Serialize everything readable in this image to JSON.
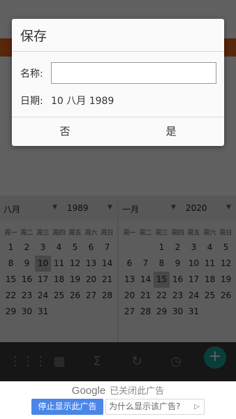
{
  "dialog": {
    "title": "保存",
    "name_label": "名称:",
    "name_value": "",
    "date_label": "日期:",
    "date_value": "10 八月 1989",
    "no_label": "否",
    "yes_label": "是"
  },
  "calendar_left": {
    "month": "八月",
    "year": "1989",
    "weekdays": [
      "周一",
      "周二",
      "周三",
      "周四",
      "周五",
      "周六",
      "周日"
    ],
    "selected": "10"
  },
  "calendar_right": {
    "month": "一月",
    "year": "2020",
    "weekdays": [
      "周一",
      "周二",
      "周三",
      "周四",
      "周五",
      "周六",
      "周日"
    ],
    "selected": "15"
  },
  "ad": {
    "brand": "Google",
    "closed_text": "已关闭此广告",
    "stop_label": "停止显示此广告",
    "why_label": "为什么显示该广告?",
    "why_icon": "▷"
  },
  "colors": {
    "accent_orange": "#e8651a",
    "fab_teal": "#1aa39a",
    "ad_blue": "#4a86e8"
  }
}
